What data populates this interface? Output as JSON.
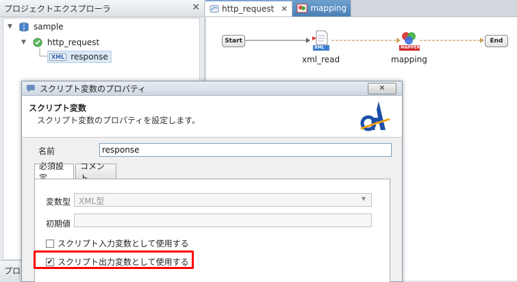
{
  "explorer": {
    "title": "プロジェクトエクスプローラ",
    "close_glyph": "✕",
    "tree": {
      "project": "sample",
      "script": "http_request",
      "variable": "response",
      "variable_icon_text": "XML"
    },
    "bottom_title": "プロ"
  },
  "editor": {
    "tabs": [
      {
        "label": "http_request",
        "close_glyph": "✕"
      },
      {
        "label": "mapping"
      }
    ],
    "flow": {
      "start": "Start",
      "end": "End",
      "xml_read": "xml_read",
      "xml_read_badge": "XML",
      "mapping": "mapping",
      "mapping_badge": "MAPPER"
    }
  },
  "dialog": {
    "title": "スクリプト変数のプロパティ",
    "close_glyph": "✕",
    "header_title": "スクリプト変数",
    "header_desc": "スクリプト変数のプロパティを設定します。",
    "name_label": "名前",
    "name_value": "response",
    "tabs": [
      "必須設定",
      "コメント"
    ],
    "type_label": "変数型",
    "type_value": "XML型",
    "initial_label": "初期値",
    "initial_value": "",
    "use_input_label": "スクリプト入力変数として使用する",
    "use_input_checked": false,
    "use_output_label": "スクリプト出力変数として使用する",
    "use_output_checked": true,
    "check_glyph": "✔"
  },
  "colors": {
    "highlight": "#ff0000",
    "tab_active_accent": "#7da2ce",
    "flow_arrow": "#c9a25a"
  }
}
